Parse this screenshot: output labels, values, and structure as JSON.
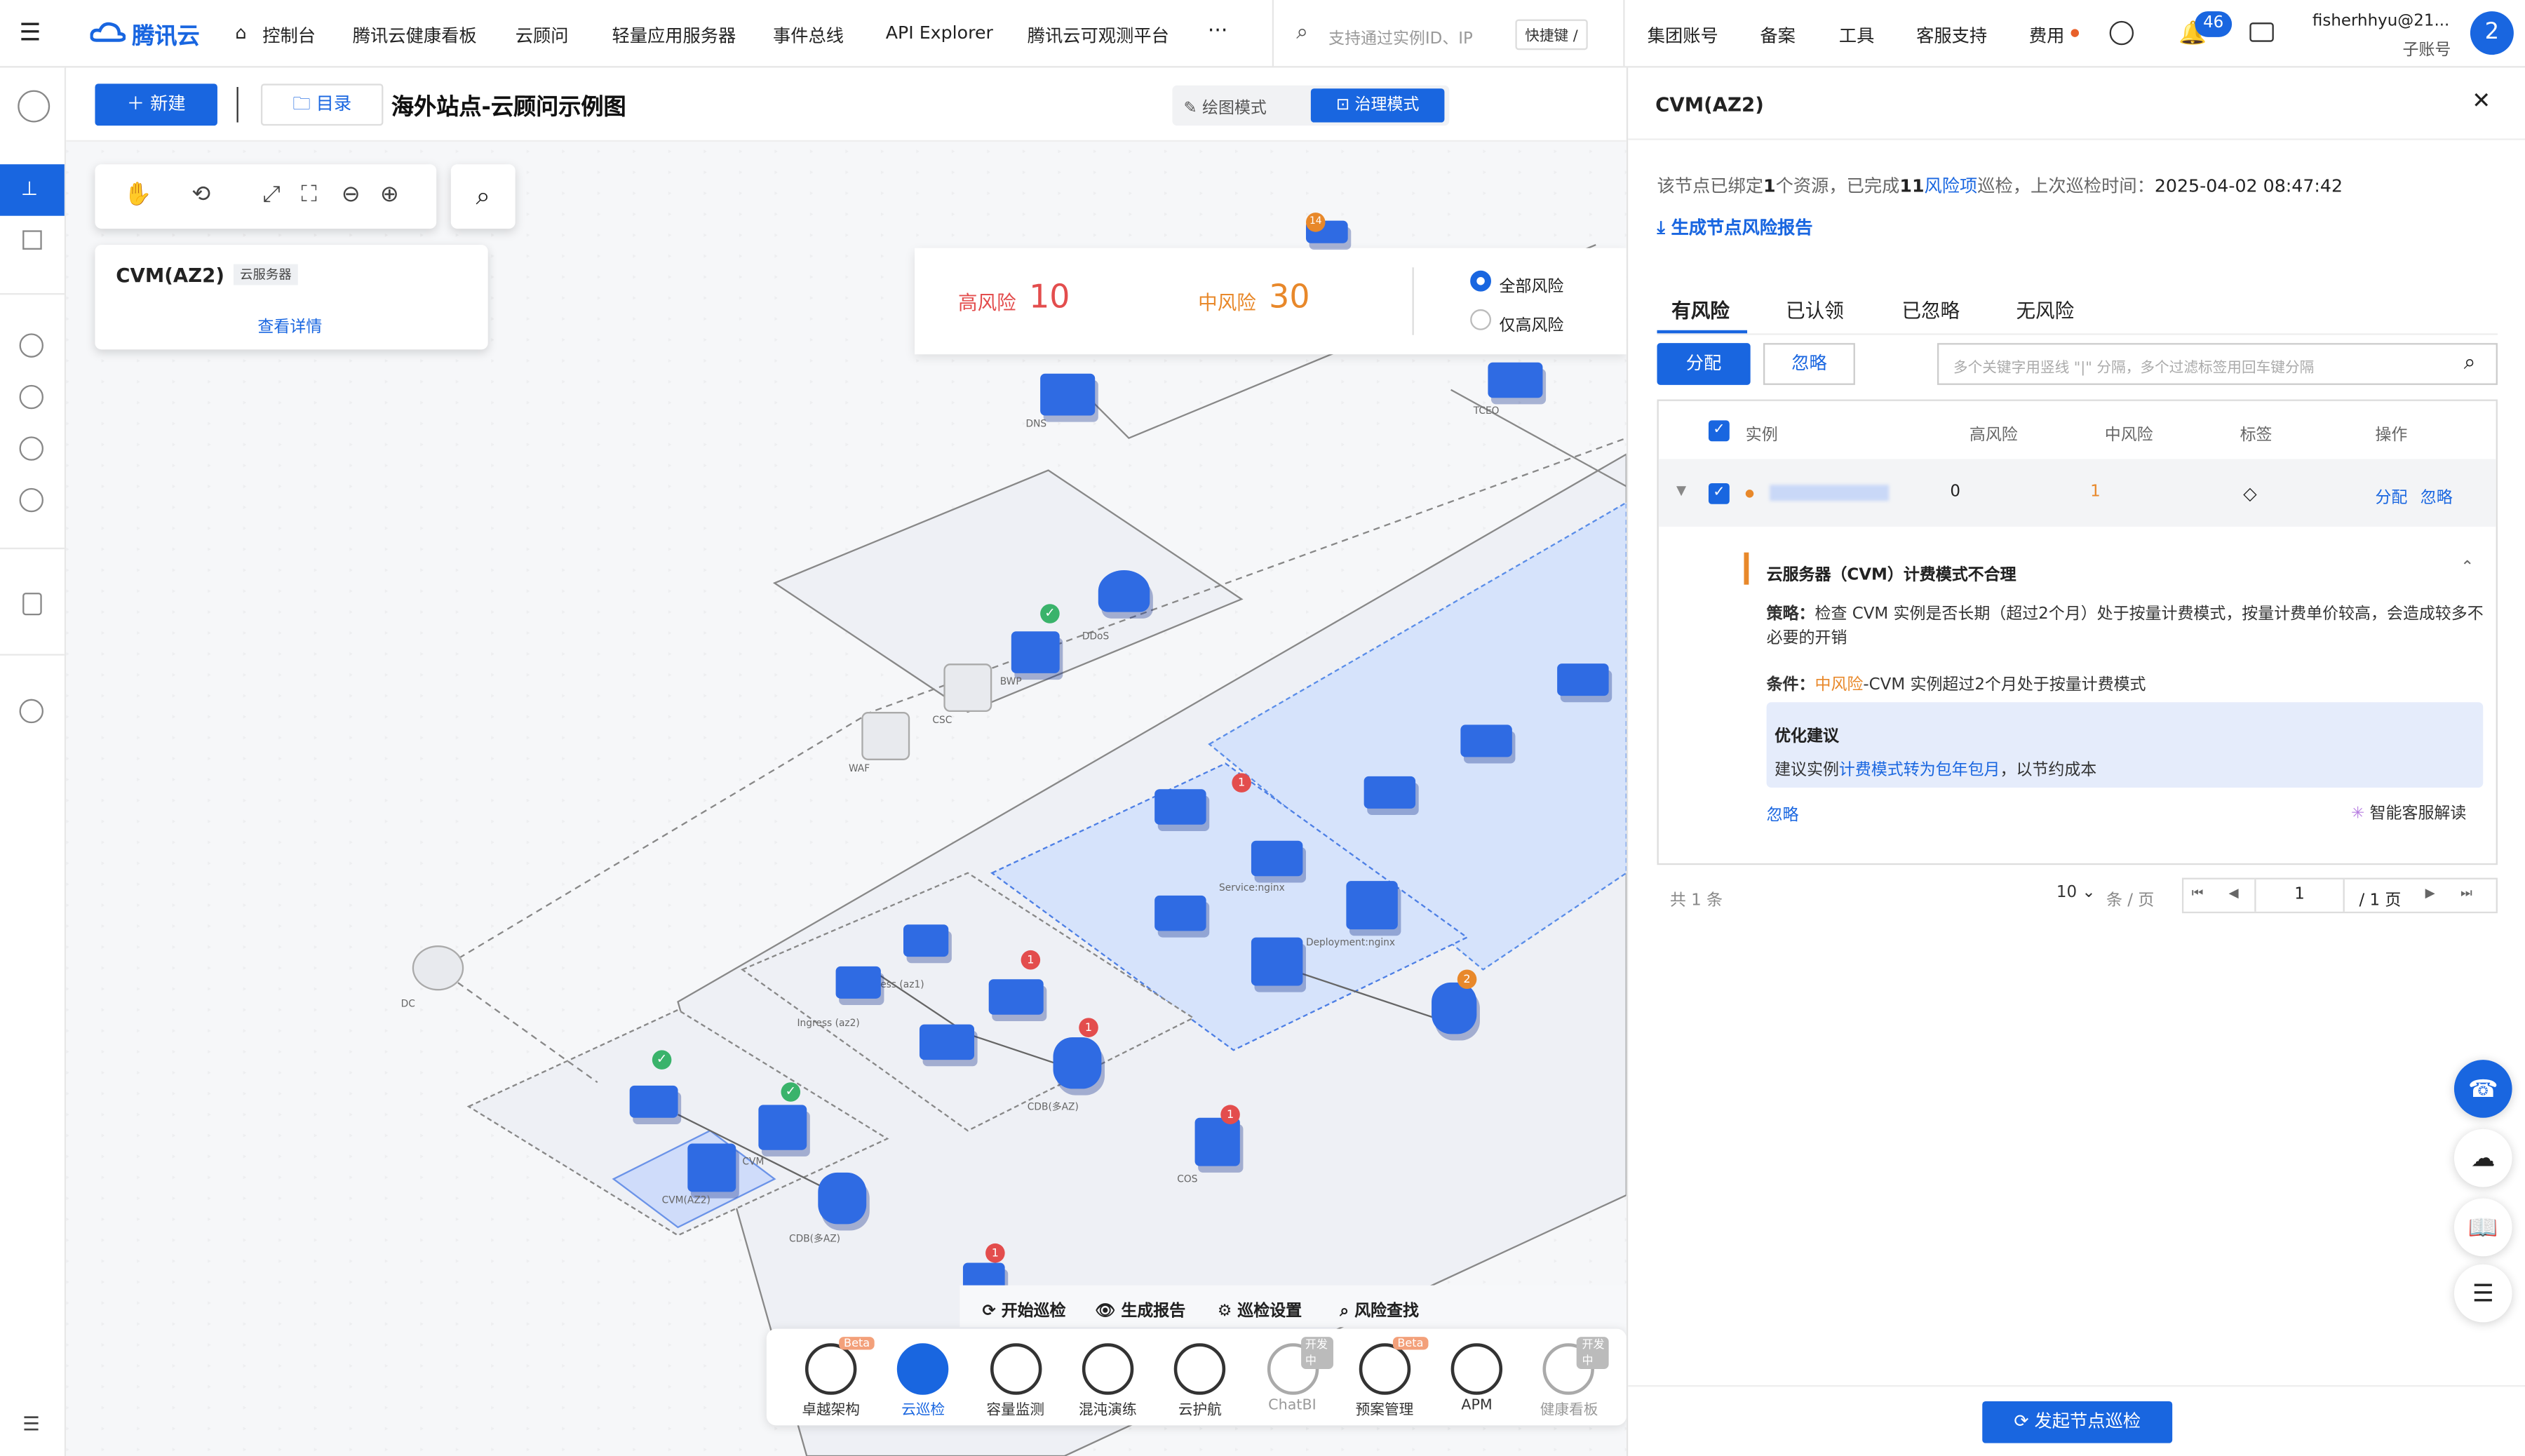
{
  "topnav": {
    "brand": "腾讯云",
    "console": "控制台",
    "items": [
      "腾讯云健康看板",
      "云顾问",
      "轻量应用服务器",
      "事件总线",
      "API Explorer",
      "腾讯云可观测平台"
    ],
    "more": "···",
    "search_placeholder": "支持通过实例ID、IP",
    "shortcut": "快捷键 /",
    "right_items": [
      "集团账号",
      "备案",
      "工具",
      "客服支持",
      "费用"
    ],
    "notif_count": "46",
    "account": "fisherhhyu@21...",
    "account_type": "子账号",
    "avatar": "2"
  },
  "toolbar": {
    "new_label": "新建",
    "dir_label": "目录",
    "title": "海外站点-云顾问示例图",
    "mode_draw": "绘图模式",
    "mode_govern": "治理模式"
  },
  "node_card": {
    "title": "CVM(AZ2)",
    "tag": "云服务器",
    "link": "查看详情"
  },
  "risk_bar": {
    "high_label": "高风险",
    "high_value": "10",
    "mid_label": "中风险",
    "mid_value": "30",
    "opt_all": "全部风险",
    "opt_high": "仅高风险"
  },
  "diagram": {
    "labels": [
      "DNS",
      "TCEO",
      "DDoS",
      "BWP",
      "CSC",
      "WAF",
      "DC",
      "Ingress (az1)",
      "Ingress (az2)",
      "CDB(多AZ)",
      "CVM(AZ2)",
      "CVM",
      "COS",
      "Service:nginx",
      "Deployment:nginx"
    ],
    "badges": [
      "14",
      "1",
      "2",
      "1",
      "1",
      "1",
      "1"
    ]
  },
  "scan_bar": {
    "start": "开始巡检",
    "report": "生成报告",
    "settings": "巡检设置",
    "find": "风险查找"
  },
  "dock": [
    {
      "label": "卓越架构",
      "badge": "Beta"
    },
    {
      "label": "云巡检",
      "badge": ""
    },
    {
      "label": "容量监测",
      "badge": ""
    },
    {
      "label": "混沌演练",
      "badge": ""
    },
    {
      "label": "云护航",
      "badge": ""
    },
    {
      "label": "ChatBI",
      "badge": "开发中"
    },
    {
      "label": "预案管理",
      "badge": "Beta"
    },
    {
      "label": "APM",
      "badge": ""
    },
    {
      "label": "健康看板",
      "badge": "开发中"
    }
  ],
  "panel": {
    "title": "CVM(AZ2)",
    "summary_pre": "该节点已绑定",
    "bound": "1",
    "summary_mid": "个资源，已完成",
    "items": "11",
    "summary_risk": "风险项",
    "summary_post": "巡检，上次巡检时间：",
    "time": "2025-04-02 08:47:42",
    "gen_report": "生成节点风险报告",
    "tabs": [
      "有风险",
      "已认领",
      "已忽略",
      "无风险"
    ],
    "assign": "分配",
    "ignore": "忽略",
    "filter_placeholder": "多个关键字用竖线 \"|\" 分隔，多个过滤标签用回车键分隔",
    "columns": [
      "实例",
      "高风险",
      "中风险",
      "标签",
      "操作"
    ],
    "row": {
      "high": "0",
      "mid": "1",
      "op_assign": "分配",
      "op_ignore": "忽略"
    },
    "detail": {
      "title": "云服务器（CVM）计费模式不合理",
      "strategy_label": "策略：",
      "strategy": "检查 CVM 实例是否长期（超过2个月）处于按量计费模式，按量计费单价较高，会造成较多不必要的开销",
      "cond_label": "条件：",
      "cond_level": "中风险",
      "cond": "-CVM 实例超过2个月处于按量计费模式",
      "sug_title": "优化建议",
      "sug_pre": "建议实例",
      "sug_link": "计费模式转为包年包月",
      "sug_post": "，以节约成本",
      "ignore": "忽略",
      "ai": "智能客服解读"
    },
    "footer": {
      "total": "共 1 条",
      "page_size": "10",
      "per_page": "条 / 页",
      "page": "1",
      "pages": "/ 1 页"
    },
    "action": "发起节点巡检"
  }
}
